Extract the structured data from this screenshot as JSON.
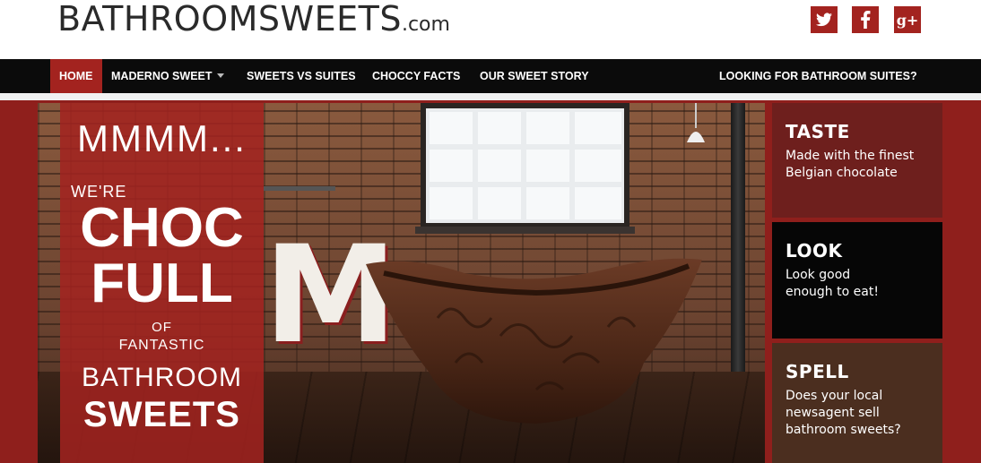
{
  "header": {
    "logo_main": "BATHROOMSWEETS",
    "logo_tld": ".com",
    "social": [
      {
        "name": "twitter",
        "icon": "twitter-icon"
      },
      {
        "name": "facebook",
        "icon": "facebook-icon"
      },
      {
        "name": "google-plus",
        "icon": "google-plus-icon",
        "label": "g+"
      }
    ]
  },
  "nav": {
    "items": [
      {
        "label": "HOME",
        "active": true
      },
      {
        "label": "MADERNO SWEET",
        "has_dropdown": true
      },
      {
        "label": "SWEETS VS SUITES"
      },
      {
        "label": "CHOCCY FACTS"
      },
      {
        "label": "OUR SWEET STORY"
      }
    ],
    "right_link": "LOOKING FOR BATHROOM SUITES?"
  },
  "hero": {
    "line1": "MMMM...",
    "line2": "WE'RE",
    "line3": "CHOC",
    "line4": "FULL",
    "line5": "OF",
    "line6": "FANTASTIC",
    "line7": "BATHROOM",
    "line8": "SWEETS"
  },
  "cards": [
    {
      "title": "TASTE",
      "text": "Made with the finest Belgian chocolate"
    },
    {
      "title": "LOOK",
      "text": "Look good enough to eat!"
    },
    {
      "title": "SPELL",
      "text": "Does your local newsagent sell bathroom sweets?"
    }
  ],
  "colors": {
    "brand_red": "#a3231f",
    "nav_bg": "#0b0b0b",
    "taste_bg": "#6e1f1d",
    "look_bg": "#060606",
    "spell_bg": "#4b2e1f"
  }
}
